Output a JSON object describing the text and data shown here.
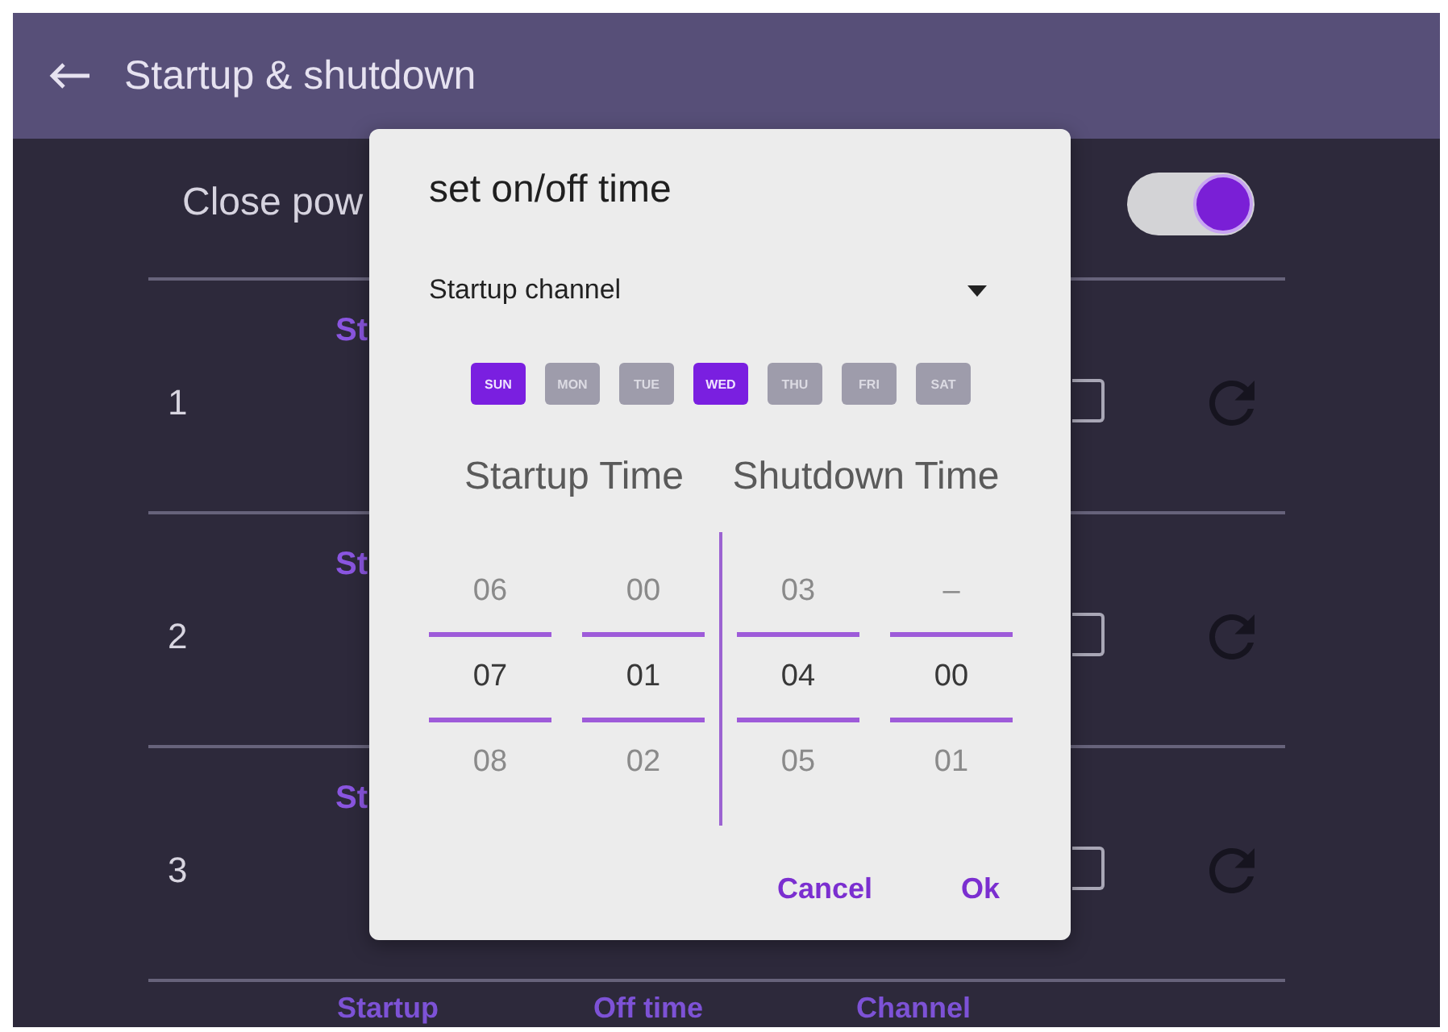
{
  "app_bar": {
    "title": "Startup & shutdown"
  },
  "power_setting": {
    "label": "Close pow",
    "on": true
  },
  "schedule_rows": [
    {
      "number": "1",
      "label": "St",
      "checked": false
    },
    {
      "number": "2",
      "label": "St",
      "checked": false
    },
    {
      "number": "3",
      "label": "St",
      "checked": false
    }
  ],
  "next_row_labels": [
    "Startup",
    "Off time",
    "Channel"
  ],
  "dialog": {
    "title": "set on/off time",
    "channel_dropdown": {
      "value": "Startup channel"
    },
    "days": [
      {
        "label": "SUN",
        "selected": true
      },
      {
        "label": "MON",
        "selected": false
      },
      {
        "label": "TUE",
        "selected": false
      },
      {
        "label": "WED",
        "selected": true
      },
      {
        "label": "THU",
        "selected": false
      },
      {
        "label": "FRI",
        "selected": false
      },
      {
        "label": "SAT",
        "selected": false
      }
    ],
    "time_groups": [
      {
        "label": "Startup Time",
        "columns": [
          {
            "previous": "06",
            "current": "07",
            "next": "08"
          },
          {
            "previous": "00",
            "current": "01",
            "next": "02"
          }
        ]
      },
      {
        "label": "Shutdown Time",
        "columns": [
          {
            "previous": "03",
            "current": "04",
            "next": "05"
          },
          {
            "previous": "–",
            "current": "00",
            "next": "01"
          }
        ]
      }
    ],
    "buttons": [
      "Cancel",
      "Ok"
    ]
  }
}
